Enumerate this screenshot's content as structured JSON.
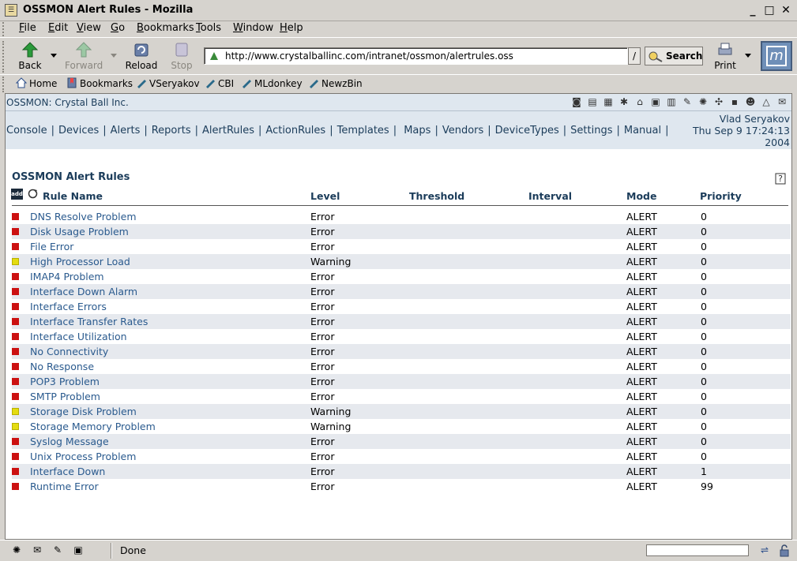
{
  "window": {
    "title": "OSSMON Alert Rules - Mozilla"
  },
  "menubar": {
    "items": [
      {
        "label": "File",
        "accel": "F",
        "rest": "ile"
      },
      {
        "label": "Edit",
        "accel": "E",
        "rest": "dit"
      },
      {
        "label": "View",
        "accel": "V",
        "rest": "iew"
      },
      {
        "label": "Go",
        "accel": "G",
        "rest": "o"
      },
      {
        "label": "Bookmarks",
        "accel": "B",
        "rest": "ookmarks"
      },
      {
        "label": "Tools",
        "accel": "T",
        "rest": "ools"
      },
      {
        "label": "Window",
        "accel": "W",
        "rest": "indow"
      },
      {
        "label": "Help",
        "accel": "H",
        "rest": "elp"
      }
    ]
  },
  "toolbar": {
    "back": "Back",
    "forward": "Forward",
    "reload": "Reload",
    "stop": "Stop",
    "url": "http://www.crystalballinc.com/intranet/ossmon/alertrules.oss",
    "search": "Search",
    "print": "Print"
  },
  "personal": {
    "home": "Home",
    "bookmarks": "Bookmarks",
    "links": [
      "VSeryakov",
      "CBI",
      "MLdonkey",
      "NewzBin"
    ]
  },
  "app": {
    "brand": "OSSMON: Crystal Ball Inc.",
    "nav": [
      "Console",
      "Devices",
      "Alerts",
      "Reports",
      "AlertRules",
      "ActionRules",
      "Templates",
      "Maps",
      "Vendors",
      "DeviceTypes",
      "Settings",
      "Manual"
    ],
    "user": "Vlad Seryakov",
    "datetime_line1": "Thu Sep 9 17:24:13",
    "datetime_line2": "2004",
    "add_label": "add"
  },
  "page": {
    "title": "OSSMON Alert Rules",
    "columns": {
      "name": "Rule Name",
      "level": "Level",
      "threshold": "Threshold",
      "interval": "Interval",
      "mode": "Mode",
      "priority": "Priority"
    }
  },
  "colors": {
    "error": "#cc1111",
    "warning": "#e4dc10",
    "link": "#2a5a8e"
  },
  "rules": [
    {
      "name": "DNS Resolve Problem",
      "severity": "error",
      "level": "Error",
      "threshold": "",
      "interval": "",
      "mode": "ALERT",
      "priority": "0"
    },
    {
      "name": "Disk Usage Problem",
      "severity": "error",
      "level": "Error",
      "threshold": "",
      "interval": "",
      "mode": "ALERT",
      "priority": "0"
    },
    {
      "name": "File Error",
      "severity": "error",
      "level": "Error",
      "threshold": "",
      "interval": "",
      "mode": "ALERT",
      "priority": "0"
    },
    {
      "name": "High Processor Load",
      "severity": "warning",
      "level": "Warning",
      "threshold": "",
      "interval": "",
      "mode": "ALERT",
      "priority": "0"
    },
    {
      "name": "IMAP4 Problem",
      "severity": "error",
      "level": "Error",
      "threshold": "",
      "interval": "",
      "mode": "ALERT",
      "priority": "0"
    },
    {
      "name": "Interface Down Alarm",
      "severity": "error",
      "level": "Error",
      "threshold": "",
      "interval": "",
      "mode": "ALERT",
      "priority": "0"
    },
    {
      "name": "Interface Errors",
      "severity": "error",
      "level": "Error",
      "threshold": "",
      "interval": "",
      "mode": "ALERT",
      "priority": "0"
    },
    {
      "name": "Interface Transfer Rates",
      "severity": "error",
      "level": "Error",
      "threshold": "",
      "interval": "",
      "mode": "ALERT",
      "priority": "0"
    },
    {
      "name": "Interface Utilization",
      "severity": "error",
      "level": "Error",
      "threshold": "",
      "interval": "",
      "mode": "ALERT",
      "priority": "0"
    },
    {
      "name": "No Connectivity",
      "severity": "error",
      "level": "Error",
      "threshold": "",
      "interval": "",
      "mode": "ALERT",
      "priority": "0"
    },
    {
      "name": "No Response",
      "severity": "error",
      "level": "Error",
      "threshold": "",
      "interval": "",
      "mode": "ALERT",
      "priority": "0"
    },
    {
      "name": "POP3 Problem",
      "severity": "error",
      "level": "Error",
      "threshold": "",
      "interval": "",
      "mode": "ALERT",
      "priority": "0"
    },
    {
      "name": "SMTP Problem",
      "severity": "error",
      "level": "Error",
      "threshold": "",
      "interval": "",
      "mode": "ALERT",
      "priority": "0"
    },
    {
      "name": "Storage Disk Problem",
      "severity": "warning",
      "level": "Warning",
      "threshold": "",
      "interval": "",
      "mode": "ALERT",
      "priority": "0"
    },
    {
      "name": "Storage Memory Problem",
      "severity": "warning",
      "level": "Warning",
      "threshold": "",
      "interval": "",
      "mode": "ALERT",
      "priority": "0"
    },
    {
      "name": "Syslog Message",
      "severity": "error",
      "level": "Error",
      "threshold": "",
      "interval": "",
      "mode": "ALERT",
      "priority": "0"
    },
    {
      "name": "Unix Process Problem",
      "severity": "error",
      "level": "Error",
      "threshold": "",
      "interval": "",
      "mode": "ALERT",
      "priority": "0"
    },
    {
      "name": "Interface Down",
      "severity": "error",
      "level": "Error",
      "threshold": "",
      "interval": "",
      "mode": "ALERT",
      "priority": "1"
    },
    {
      "name": "Runtime Error",
      "severity": "error",
      "level": "Error",
      "threshold": "",
      "interval": "",
      "mode": "ALERT",
      "priority": "99"
    }
  ],
  "status": {
    "text": "Done"
  }
}
